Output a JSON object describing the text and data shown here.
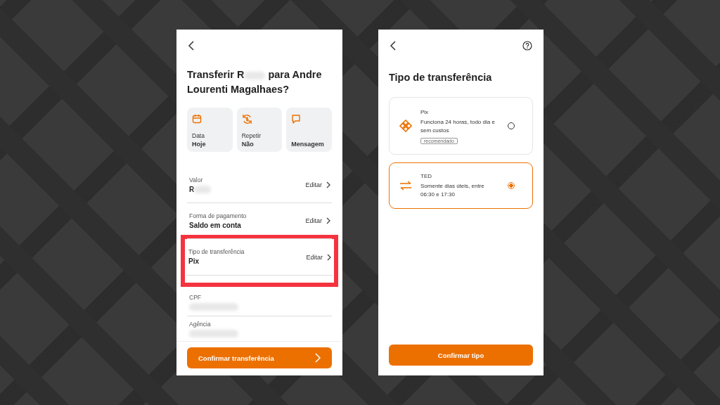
{
  "confirm_screen": {
    "title_prefix": "Transferir R",
    "title_masked": true,
    "title_suffix": "para Andre Lourenti Magalhaes?",
    "shortcuts": [
      {
        "kind": "calendar",
        "label": "Data",
        "value": "Hoje"
      },
      {
        "kind": "repeat",
        "label": "Repetir",
        "value": "Não"
      },
      {
        "kind": "message",
        "value": "Mensagem"
      }
    ],
    "rows": [
      {
        "label": "Valor",
        "value": "R",
        "masked": true,
        "action": "Editar",
        "highlighted": false
      },
      {
        "label": "Forma de pagamento",
        "value": "Saldo em conta",
        "masked": false,
        "action": "Editar",
        "highlighted": false
      },
      {
        "label": "Tipo de transferência",
        "value": "Pix",
        "masked": false,
        "action": "Editar",
        "highlighted": true
      },
      {
        "label": "CPF",
        "masked": true,
        "highlighted": false
      },
      {
        "label": "Agência",
        "masked": true,
        "highlighted": false
      }
    ],
    "button": "Confirmar transferência"
  },
  "type_screen": {
    "title": "Tipo de transferência",
    "options": [
      {
        "kind": "pix",
        "name": "Pix",
        "description": "Funciona 24 horas, todo dia e sem custos",
        "tag": "recomendado",
        "selected": false
      },
      {
        "kind": "arrows",
        "name": "TED",
        "description": "Somente dias úteis, entre 06:30 e 17:30",
        "selected": true
      }
    ],
    "button": "Confirmar tipo"
  }
}
